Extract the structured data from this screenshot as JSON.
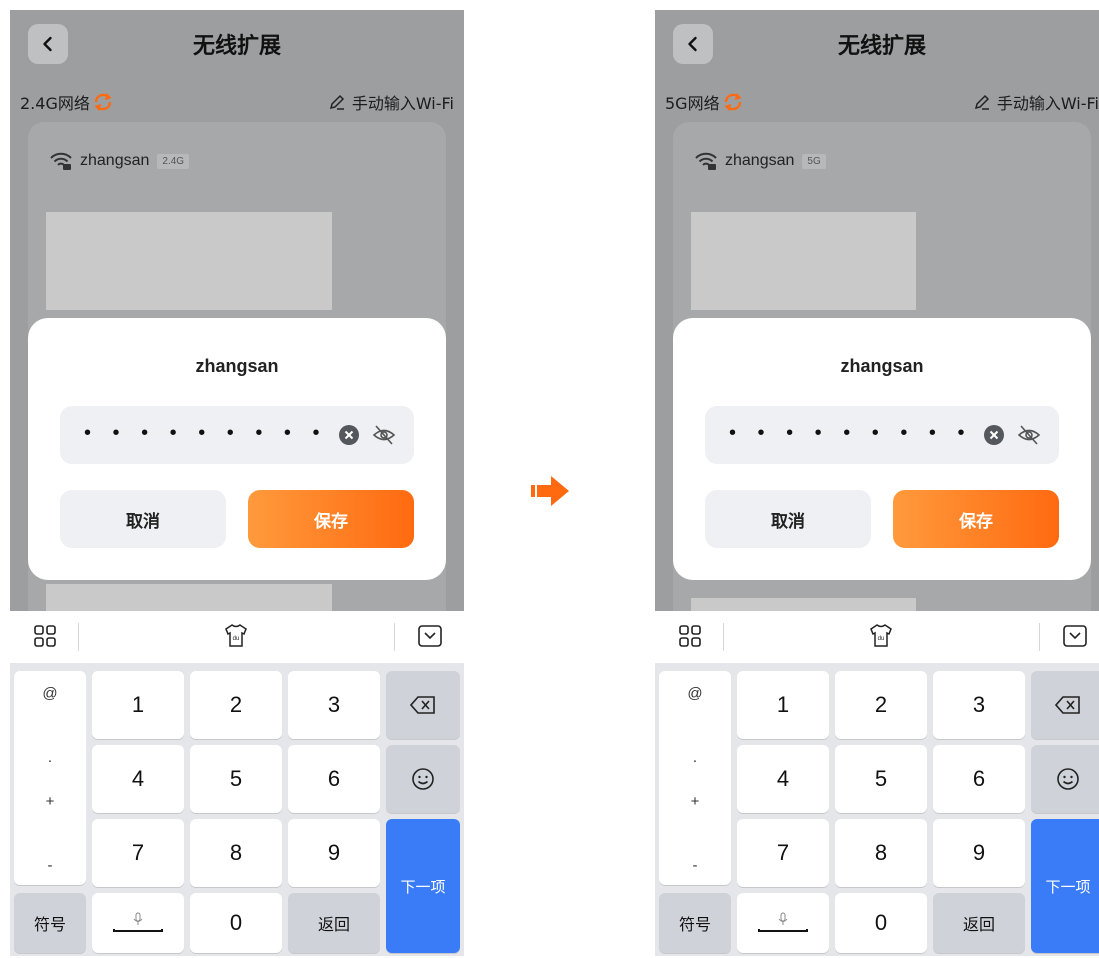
{
  "screens": [
    {
      "title": "无线扩展",
      "band_label": "2.4G网络",
      "manual_entry_label": "手动输入Wi-Fi",
      "ssid": "zhangsan",
      "band_badge": "2.4G",
      "dialog": {
        "title": "zhangsan",
        "password_masked": "• • • • • • • • •",
        "cancel_label": "取消",
        "save_label": "保存"
      }
    },
    {
      "title": "无线扩展",
      "band_label": "5G网络",
      "manual_entry_label": "手动输入Wi-Fi",
      "ssid": "zhangsan",
      "band_badge": "5G",
      "dialog": {
        "title": "zhangsan",
        "password_masked": "• • • • • • • • •",
        "cancel_label": "取消",
        "save_label": "保存"
      }
    }
  ],
  "keyboard": {
    "symbols": [
      "@",
      ".",
      "+",
      "-"
    ],
    "digits": [
      "1",
      "2",
      "3",
      "4",
      "5",
      "6",
      "7",
      "8",
      "9",
      "0"
    ],
    "symbol_key": "符号",
    "return_key": "返回",
    "next_key": "下一项"
  },
  "colors": {
    "accent_orange": "#ff7a1a",
    "next_blue": "#3a7bf7",
    "overlay_gray": "#9d9e9f"
  },
  "icons": {
    "back": "chevron-left-icon",
    "refresh": "refresh-icon",
    "manual": "pen-icon",
    "wifi": "wifi-icon",
    "clear": "clear-icon",
    "visibility": "eye-off-icon",
    "keyboard_menu": "grid-icon",
    "skin": "tshirt-icon",
    "collapse": "keyboard-collapse-icon",
    "backspace": "backspace-icon",
    "emoji": "emoji-icon",
    "microphone": "mic-icon",
    "transition": "arrow-right-icon"
  }
}
